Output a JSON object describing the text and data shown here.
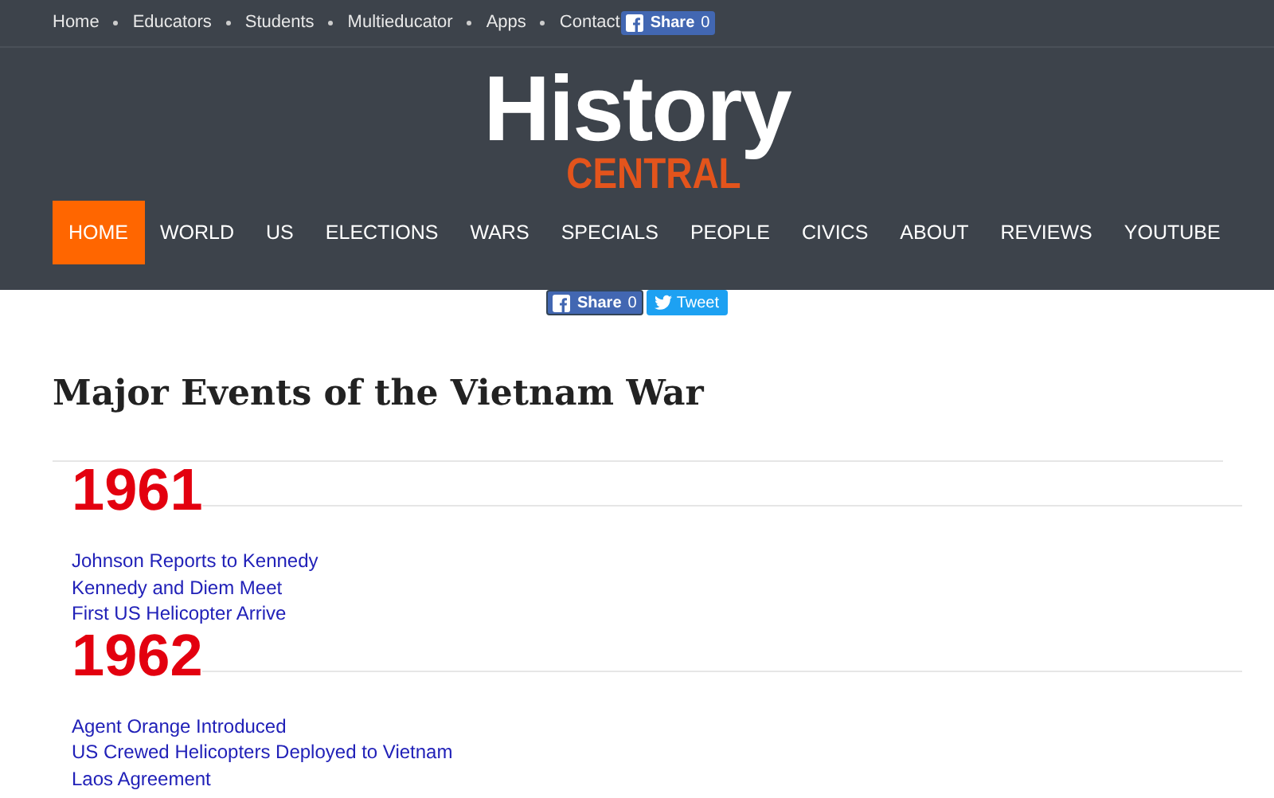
{
  "top_links": [
    "Home",
    "Educators",
    "Students",
    "Multieducator",
    "Apps",
    "Contact"
  ],
  "top_share": {
    "label": "Share",
    "count": "0"
  },
  "logo": {
    "main": "History",
    "sub": "CENTRAL"
  },
  "nav": [
    {
      "label": "HOME",
      "selected": true
    },
    {
      "label": "WORLD",
      "selected": false
    },
    {
      "label": "US",
      "selected": false
    },
    {
      "label": "ELECTIONS",
      "selected": false
    },
    {
      "label": "WARS",
      "selected": false
    },
    {
      "label": "SPECIALS",
      "selected": false
    },
    {
      "label": "PEOPLE",
      "selected": false
    },
    {
      "label": "CIVICS",
      "selected": false
    },
    {
      "label": "ABOUT",
      "selected": false
    },
    {
      "label": "REVIEWS",
      "selected": false
    },
    {
      "label": "YOUTUBE",
      "selected": false
    }
  ],
  "social": {
    "share": "Share",
    "count": "0",
    "tweet": "Tweet"
  },
  "title": "Major Events of the Vietnam War",
  "years": [
    {
      "year": "1961",
      "events": [
        "Johnson Reports to Kennedy",
        "Kennedy and Diem Meet",
        "First US Helicopter Arrive"
      ]
    },
    {
      "year": "1962",
      "events": [
        "Agent Orange Introduced",
        "US Crewed Helicopters Deployed to Vietnam",
        "Laos Agreement"
      ]
    }
  ]
}
